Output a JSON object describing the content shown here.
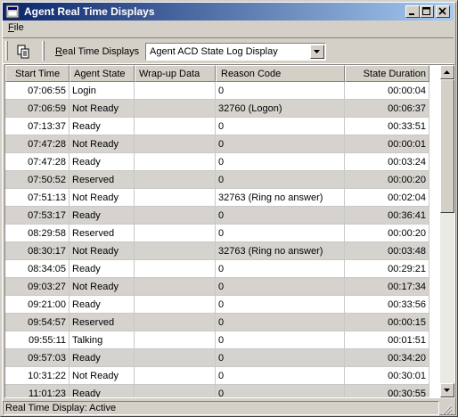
{
  "window": {
    "title": "Agent Real Time Displays",
    "minimize_label": "_",
    "maximize_label": "□",
    "close_label": "✕"
  },
  "menu": {
    "file_prefix": "F",
    "file_rest": "ile"
  },
  "toolbar": {
    "rtd_label_prefix": "R",
    "rtd_label_rest": "eal Time Displays",
    "combo_value": "Agent ACD State Log Display"
  },
  "grid": {
    "columns": [
      "Start Time",
      "Agent State",
      "Wrap-up Data",
      "Reason Code",
      "State Duration"
    ],
    "rows": [
      [
        "07:06:55",
        "Login",
        "",
        "0",
        "00:00:04"
      ],
      [
        "07:06:59",
        "Not Ready",
        "",
        "32760 (Logon)",
        "00:06:37"
      ],
      [
        "07:13:37",
        "Ready",
        "",
        "0",
        "00:33:51"
      ],
      [
        "07:47:28",
        "Not Ready",
        "",
        "0",
        "00:00:01"
      ],
      [
        "07:47:28",
        "Ready",
        "",
        "0",
        "00:03:24"
      ],
      [
        "07:50:52",
        "Reserved",
        "",
        "0",
        "00:00:20"
      ],
      [
        "07:51:13",
        "Not Ready",
        "",
        "32763 (Ring no answer)",
        "00:02:04"
      ],
      [
        "07:53:17",
        "Ready",
        "",
        "0",
        "00:36:41"
      ],
      [
        "08:29:58",
        "Reserved",
        "",
        "0",
        "00:00:20"
      ],
      [
        "08:30:17",
        "Not Ready",
        "",
        "32763 (Ring no answer)",
        "00:03:48"
      ],
      [
        "08:34:05",
        "Ready",
        "",
        "0",
        "00:29:21"
      ],
      [
        "09:03:27",
        "Not Ready",
        "",
        "0",
        "00:17:34"
      ],
      [
        "09:21:00",
        "Ready",
        "",
        "0",
        "00:33:56"
      ],
      [
        "09:54:57",
        "Reserved",
        "",
        "0",
        "00:00:15"
      ],
      [
        "09:55:11",
        "Talking",
        "",
        "0",
        "00:01:51"
      ],
      [
        "09:57:03",
        "Ready",
        "",
        "0",
        "00:34:20"
      ],
      [
        "10:31:22",
        "Not Ready",
        "",
        "0",
        "00:30:01"
      ],
      [
        "11:01:23",
        "Ready",
        "",
        "0",
        "00:30:55"
      ]
    ]
  },
  "status": {
    "text": "Real Time Display: Active"
  }
}
